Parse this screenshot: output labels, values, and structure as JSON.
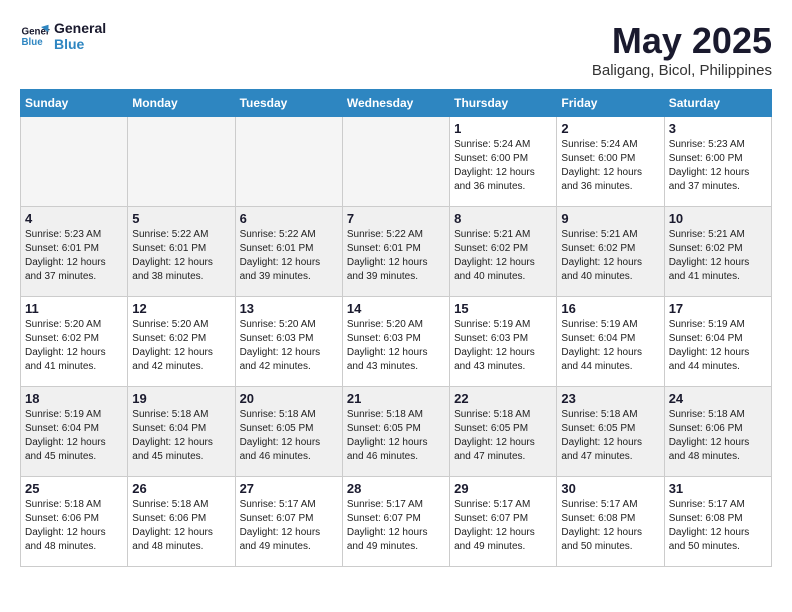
{
  "logo": {
    "line1": "General",
    "line2": "Blue"
  },
  "title": "May 2025",
  "subtitle": "Baligang, Bicol, Philippines",
  "headers": [
    "Sunday",
    "Monday",
    "Tuesday",
    "Wednesday",
    "Thursday",
    "Friday",
    "Saturday"
  ],
  "weeks": [
    [
      {
        "day": "",
        "info": ""
      },
      {
        "day": "",
        "info": ""
      },
      {
        "day": "",
        "info": ""
      },
      {
        "day": "",
        "info": ""
      },
      {
        "day": "1",
        "info": "Sunrise: 5:24 AM\nSunset: 6:00 PM\nDaylight: 12 hours\nand 36 minutes."
      },
      {
        "day": "2",
        "info": "Sunrise: 5:24 AM\nSunset: 6:00 PM\nDaylight: 12 hours\nand 36 minutes."
      },
      {
        "day": "3",
        "info": "Sunrise: 5:23 AM\nSunset: 6:00 PM\nDaylight: 12 hours\nand 37 minutes."
      }
    ],
    [
      {
        "day": "4",
        "info": "Sunrise: 5:23 AM\nSunset: 6:01 PM\nDaylight: 12 hours\nand 37 minutes."
      },
      {
        "day": "5",
        "info": "Sunrise: 5:22 AM\nSunset: 6:01 PM\nDaylight: 12 hours\nand 38 minutes."
      },
      {
        "day": "6",
        "info": "Sunrise: 5:22 AM\nSunset: 6:01 PM\nDaylight: 12 hours\nand 39 minutes."
      },
      {
        "day": "7",
        "info": "Sunrise: 5:22 AM\nSunset: 6:01 PM\nDaylight: 12 hours\nand 39 minutes."
      },
      {
        "day": "8",
        "info": "Sunrise: 5:21 AM\nSunset: 6:02 PM\nDaylight: 12 hours\nand 40 minutes."
      },
      {
        "day": "9",
        "info": "Sunrise: 5:21 AM\nSunset: 6:02 PM\nDaylight: 12 hours\nand 40 minutes."
      },
      {
        "day": "10",
        "info": "Sunrise: 5:21 AM\nSunset: 6:02 PM\nDaylight: 12 hours\nand 41 minutes."
      }
    ],
    [
      {
        "day": "11",
        "info": "Sunrise: 5:20 AM\nSunset: 6:02 PM\nDaylight: 12 hours\nand 41 minutes."
      },
      {
        "day": "12",
        "info": "Sunrise: 5:20 AM\nSunset: 6:02 PM\nDaylight: 12 hours\nand 42 minutes."
      },
      {
        "day": "13",
        "info": "Sunrise: 5:20 AM\nSunset: 6:03 PM\nDaylight: 12 hours\nand 42 minutes."
      },
      {
        "day": "14",
        "info": "Sunrise: 5:20 AM\nSunset: 6:03 PM\nDaylight: 12 hours\nand 43 minutes."
      },
      {
        "day": "15",
        "info": "Sunrise: 5:19 AM\nSunset: 6:03 PM\nDaylight: 12 hours\nand 43 minutes."
      },
      {
        "day": "16",
        "info": "Sunrise: 5:19 AM\nSunset: 6:04 PM\nDaylight: 12 hours\nand 44 minutes."
      },
      {
        "day": "17",
        "info": "Sunrise: 5:19 AM\nSunset: 6:04 PM\nDaylight: 12 hours\nand 44 minutes."
      }
    ],
    [
      {
        "day": "18",
        "info": "Sunrise: 5:19 AM\nSunset: 6:04 PM\nDaylight: 12 hours\nand 45 minutes."
      },
      {
        "day": "19",
        "info": "Sunrise: 5:18 AM\nSunset: 6:04 PM\nDaylight: 12 hours\nand 45 minutes."
      },
      {
        "day": "20",
        "info": "Sunrise: 5:18 AM\nSunset: 6:05 PM\nDaylight: 12 hours\nand 46 minutes."
      },
      {
        "day": "21",
        "info": "Sunrise: 5:18 AM\nSunset: 6:05 PM\nDaylight: 12 hours\nand 46 minutes."
      },
      {
        "day": "22",
        "info": "Sunrise: 5:18 AM\nSunset: 6:05 PM\nDaylight: 12 hours\nand 47 minutes."
      },
      {
        "day": "23",
        "info": "Sunrise: 5:18 AM\nSunset: 6:05 PM\nDaylight: 12 hours\nand 47 minutes."
      },
      {
        "day": "24",
        "info": "Sunrise: 5:18 AM\nSunset: 6:06 PM\nDaylight: 12 hours\nand 48 minutes."
      }
    ],
    [
      {
        "day": "25",
        "info": "Sunrise: 5:18 AM\nSunset: 6:06 PM\nDaylight: 12 hours\nand 48 minutes."
      },
      {
        "day": "26",
        "info": "Sunrise: 5:18 AM\nSunset: 6:06 PM\nDaylight: 12 hours\nand 48 minutes."
      },
      {
        "day": "27",
        "info": "Sunrise: 5:17 AM\nSunset: 6:07 PM\nDaylight: 12 hours\nand 49 minutes."
      },
      {
        "day": "28",
        "info": "Sunrise: 5:17 AM\nSunset: 6:07 PM\nDaylight: 12 hours\nand 49 minutes."
      },
      {
        "day": "29",
        "info": "Sunrise: 5:17 AM\nSunset: 6:07 PM\nDaylight: 12 hours\nand 49 minutes."
      },
      {
        "day": "30",
        "info": "Sunrise: 5:17 AM\nSunset: 6:08 PM\nDaylight: 12 hours\nand 50 minutes."
      },
      {
        "day": "31",
        "info": "Sunrise: 5:17 AM\nSunset: 6:08 PM\nDaylight: 12 hours\nand 50 minutes."
      }
    ]
  ]
}
